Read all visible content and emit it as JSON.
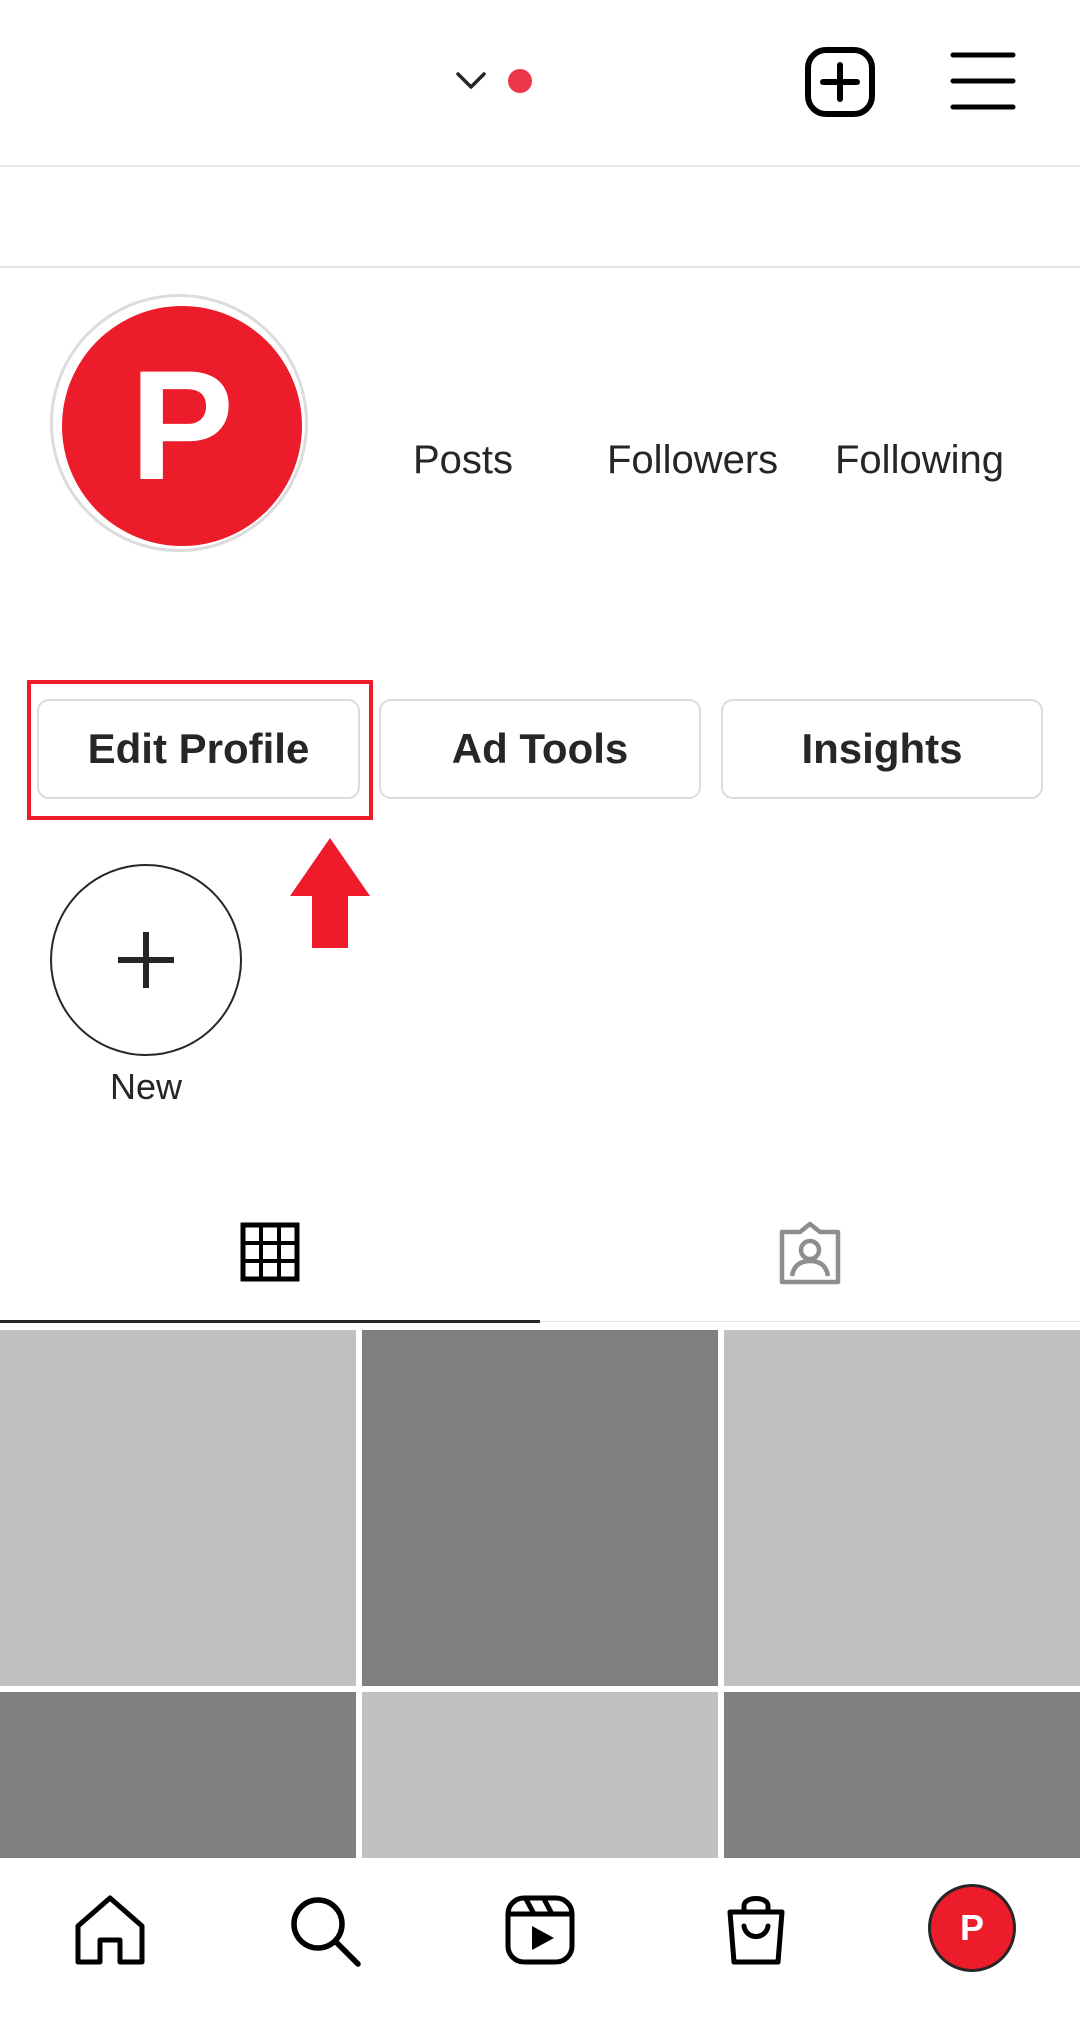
{
  "profile": {
    "avatar_letter": "P",
    "stats": {
      "posts_label": "Posts",
      "followers_label": "Followers",
      "following_label": "Following"
    }
  },
  "actions": {
    "edit_profile": "Edit Profile",
    "ad_tools": "Ad Tools",
    "insights": "Insights"
  },
  "highlights": {
    "new_label": "New"
  },
  "bottom_nav": {
    "profile_letter": "P"
  },
  "colors": {
    "brand_red": "#ed1c2a",
    "notification_dot": "#ed3748",
    "tile_light": "#c0c0c0",
    "tile_dark": "#808080"
  },
  "icons": {
    "header": [
      "chevron-down-icon",
      "notification-dot",
      "create-post-icon",
      "hamburger-menu-icon"
    ],
    "tabs": [
      "grid-icon",
      "tagged-icon"
    ],
    "nav": [
      "home-icon",
      "search-icon",
      "reels-icon",
      "shop-icon",
      "profile-avatar"
    ]
  },
  "posts_grid": {
    "columns": 3,
    "tiles": [
      "light",
      "dark",
      "light",
      "dark",
      "light",
      "dark"
    ]
  }
}
